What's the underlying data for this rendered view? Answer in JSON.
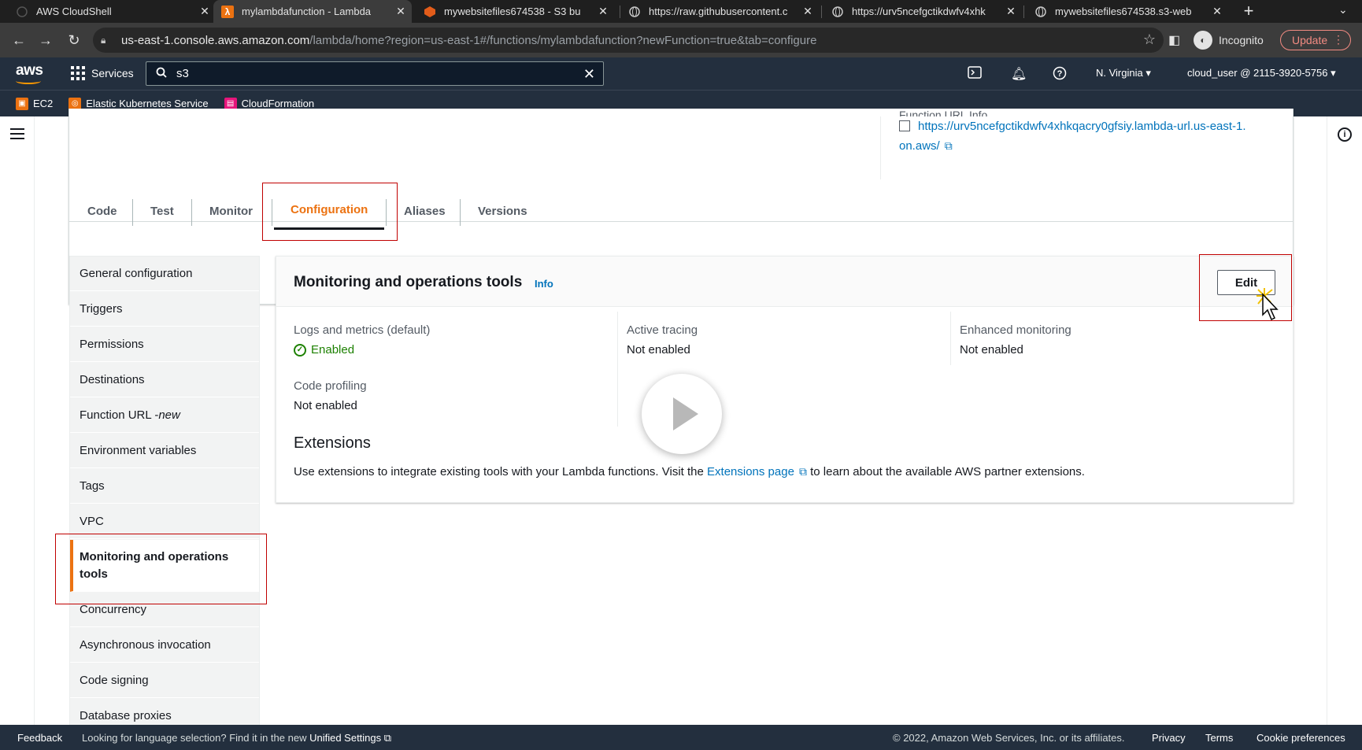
{
  "browser": {
    "tabs": [
      {
        "title": "AWS CloudShell",
        "icon": "cloudshell-icon"
      },
      {
        "title": "mylambdafunction - Lambda",
        "icon": "lambda-icon"
      },
      {
        "title": "mywebsitefiles674538 - S3 bu",
        "icon": "s3-icon"
      },
      {
        "title": "https://raw.githubusercontent.c",
        "icon": "globe-icon"
      },
      {
        "title": "https://urv5ncefgctikdwfv4xhk",
        "icon": "globe-icon"
      },
      {
        "title": "mywebsitefiles674538.s3-web",
        "icon": "globe-icon"
      }
    ],
    "url_host": "us-east-1.console.aws.amazon.com",
    "url_path": "/lambda/home?region=us-east-1#/functions/mylambdafunction?newFunction=true&tab=configure",
    "incognito_label": "Incognito",
    "update_label": "Update"
  },
  "aws_header": {
    "logo": "aws",
    "services_label": "Services",
    "search_value": "s3",
    "region": "N. Virginia ▾",
    "account": "cloud_user @ 2115-3920-5756 ▾"
  },
  "favorites": [
    {
      "label": "EC2",
      "color": "#ec7211"
    },
    {
      "label": "Elastic Kubernetes Service",
      "color": "#ec7211"
    },
    {
      "label": "CloudFormation",
      "color": "#e7157b"
    }
  ],
  "function_overview": {
    "url_label": "Function URL Info",
    "url": "https://urv5ncefgctikdwfv4xhkqacry0gfsiy.lambda-url.us-east-1.",
    "url_tail": "on.aws/"
  },
  "config_tabs": [
    "Code",
    "Test",
    "Monitor",
    "Configuration",
    "Aliases",
    "Versions"
  ],
  "side_menu": [
    "General configuration",
    "Triggers",
    "Permissions",
    "Destinations",
    "Function URL - ",
    "Environment variables",
    "Tags",
    "VPC",
    "Monitoring and operations tools",
    "Concurrency",
    "Asynchronous invocation",
    "Code signing",
    "Database proxies"
  ],
  "side_menu_new_tag": "new",
  "panel": {
    "title": "Monitoring and operations tools",
    "info": "Info",
    "edit_label": "Edit",
    "logs_label": "Logs and metrics (default)",
    "logs_value": "Enabled",
    "tracing_label": "Active tracing",
    "tracing_value": "Not enabled",
    "enhanced_label": "Enhanced monitoring",
    "enhanced_value": "Not enabled",
    "profiling_label": "Code profiling",
    "profiling_value": "Not enabled",
    "ext_title": "Extensions",
    "ext_text_pre": "Use extensions to integrate existing tools with your Lambda functions. Visit the ",
    "ext_link": "Extensions page",
    "ext_text_post": " to learn about the available AWS partner extensions."
  },
  "footer": {
    "feedback": "Feedback",
    "lang_text": "Looking for language selection? Find it in the new ",
    "unified": "Unified Settings",
    "copyright": "© 2022, Amazon Web Services, Inc. or its affiliates.",
    "privacy": "Privacy",
    "terms": "Terms",
    "cookies": "Cookie preferences"
  }
}
